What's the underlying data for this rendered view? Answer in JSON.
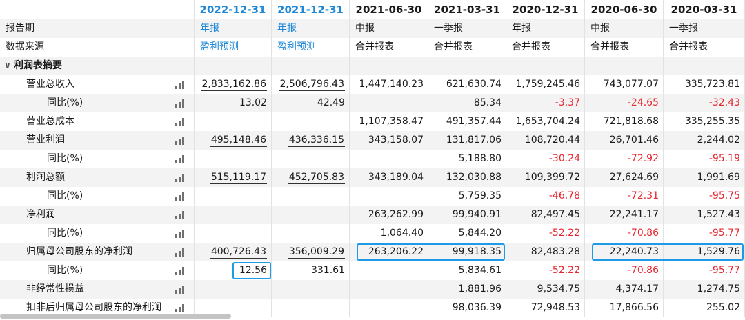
{
  "columns": [
    {
      "date": "2022-12-31",
      "highlight": true,
      "type": "年报",
      "source": "盈利预测",
      "source_blue": true
    },
    {
      "date": "2021-12-31",
      "highlight": true,
      "type": "年报",
      "source": "盈利预测",
      "source_blue": true
    },
    {
      "date": "2021-06-30",
      "highlight": false,
      "type": "中报",
      "source": "合并报表",
      "source_blue": false
    },
    {
      "date": "2021-03-31",
      "highlight": false,
      "type": "一季报",
      "source": "合并报表",
      "source_blue": false
    },
    {
      "date": "2020-12-31",
      "highlight": false,
      "type": "年报",
      "source": "合并报表",
      "source_blue": false
    },
    {
      "date": "2020-06-30",
      "highlight": false,
      "type": "中报",
      "source": "合并报表",
      "source_blue": false
    },
    {
      "date": "2020-03-31",
      "highlight": false,
      "type": "一季报",
      "source": "合并报表",
      "source_blue": false
    }
  ],
  "labels": {
    "report_period": "报告期",
    "data_source": "数据来源",
    "section": "利润表摘要"
  },
  "rows": [
    {
      "label": "营业总收入",
      "level": 1,
      "values": [
        "2,833,162.86",
        "2,506,796.43",
        "1,447,140.23",
        "621,630.74",
        "1,759,245.46",
        "743,077.07",
        "335,723.81"
      ]
    },
    {
      "label": "同比(%)",
      "level": 2,
      "values": [
        "13.02",
        "42.49",
        "",
        "85.34",
        "-3.37",
        "-24.65",
        "-32.43"
      ]
    },
    {
      "label": "营业总成本",
      "level": 1,
      "values": [
        "",
        "",
        "1,107,358.47",
        "491,357.44",
        "1,653,704.24",
        "721,818.68",
        "335,255.35"
      ]
    },
    {
      "label": "营业利润",
      "level": 1,
      "values": [
        "495,148.46",
        "436,336.15",
        "343,158.07",
        "131,817.06",
        "108,720.44",
        "26,701.46",
        "2,244.02"
      ]
    },
    {
      "label": "同比(%)",
      "level": 2,
      "values": [
        "",
        "",
        "",
        "5,188.80",
        "-30.24",
        "-72.92",
        "-95.19"
      ]
    },
    {
      "label": "利润总额",
      "level": 1,
      "values": [
        "515,119.17",
        "452,705.83",
        "343,189.04",
        "132,030.88",
        "109,399.72",
        "27,624.69",
        "1,991.69"
      ]
    },
    {
      "label": "同比(%)",
      "level": 2,
      "values": [
        "",
        "",
        "",
        "5,759.35",
        "-46.78",
        "-72.31",
        "-95.75"
      ]
    },
    {
      "label": "净利润",
      "level": 1,
      "values": [
        "",
        "",
        "263,262.99",
        "99,940.91",
        "82,497.45",
        "22,241.17",
        "1,527.43"
      ]
    },
    {
      "label": "同比(%)",
      "level": 2,
      "values": [
        "",
        "",
        "1,064.40",
        "5,844.20",
        "-52.22",
        "-70.86",
        "-95.77"
      ]
    },
    {
      "label": "归属母公司股东的净利润",
      "level": 1,
      "values": [
        "400,726.43",
        "356,009.29",
        "263,206.22",
        "99,918.35",
        "82,483.28",
        "22,240.73",
        "1,529.76"
      ]
    },
    {
      "label": "同比(%)",
      "level": 2,
      "values": [
        "12.56",
        "331.61",
        "",
        "5,834.61",
        "-52.22",
        "-70.86",
        "-95.77"
      ]
    },
    {
      "label": "非经常性损益",
      "level": 1,
      "values": [
        "",
        "",
        "",
        "1,881.96",
        "9,534.75",
        "4,374.17",
        "1,274.75"
      ]
    },
    {
      "label": "扣非后归属母公司股东的净利润",
      "level": 1,
      "values": [
        "",
        "",
        "",
        "98,036.39",
        "72,948.53",
        "17,866.56",
        "255.02"
      ]
    }
  ],
  "underlined_rows": [
    0,
    3,
    5,
    9
  ],
  "highlights": [
    {
      "row": 9,
      "from": 2,
      "to": 3
    },
    {
      "row": 9,
      "from": 5,
      "to": 6
    },
    {
      "row": 10,
      "from": 0,
      "to": 0
    }
  ],
  "colors": {
    "accent": "#1e88d7",
    "negative": "#e8262f",
    "highlight_box": "#1e9be5",
    "row_alt": "#f3f3f3"
  }
}
